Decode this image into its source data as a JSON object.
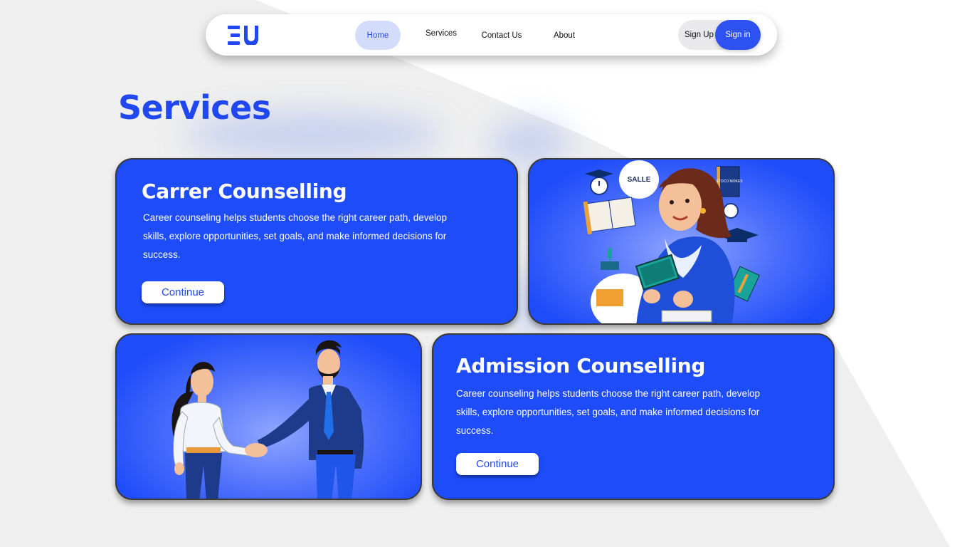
{
  "nav": {
    "logo_text": "EU",
    "links": [
      "Home",
      "Services",
      "Contact Us",
      "About"
    ],
    "signup_label": "Sign Up",
    "signin_label": "Sign in"
  },
  "page": {
    "title": "Services"
  },
  "cards": [
    {
      "title": "Carrer Counselling",
      "text": "Career counseling helps students choose the right career path, develop skills, explore opportunities, set goals, and make informed decisions for success.",
      "button": "Continue"
    },
    {
      "title": "Admission Counselling",
      "text": "Career counseling helps students choose the right career path, develop skills, explore opportunities, set goals, and make informed decisions for success.",
      "button": "Continue"
    }
  ],
  "illustrations": {
    "student": {
      "speech_text": "SALLE",
      "book_text": "STOCO MOKES"
    }
  },
  "colors": {
    "primary": "#1e4cf9",
    "title": "#2147f0",
    "home_pill": "#d3dcfb"
  }
}
